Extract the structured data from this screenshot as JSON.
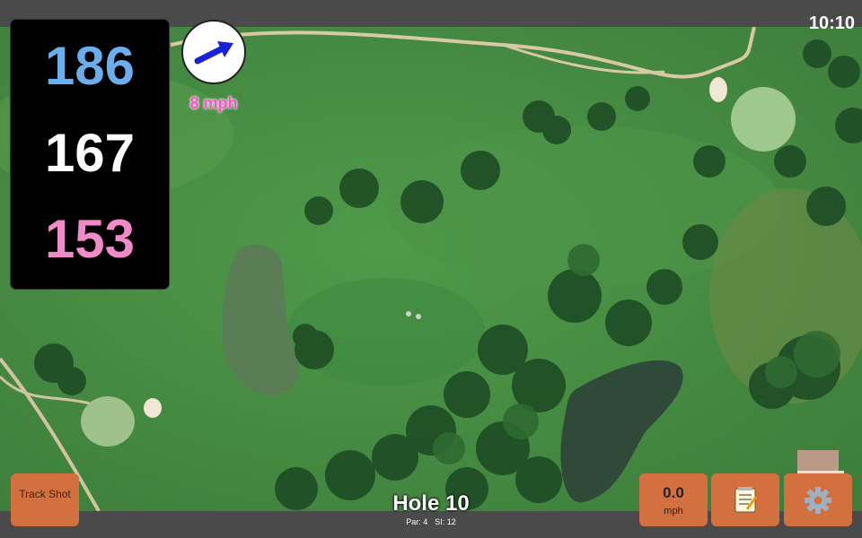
{
  "status": {
    "time": "10:10"
  },
  "distances": {
    "back": "186",
    "middle": "167",
    "front": "153"
  },
  "wind": {
    "speed_label": "8 mph",
    "direction_icon": "wind-arrow-icon"
  },
  "hole": {
    "title": "Hole 10",
    "par": "Par: 4",
    "si": "SI: 12"
  },
  "buttons": {
    "track_shot": "Track Shot",
    "wind_value": "0.0",
    "wind_unit": "mph",
    "notes_icon": "notepad-icon",
    "settings_icon": "gear-icon"
  },
  "colors": {
    "back": "#6aaeee",
    "middle": "#ffffff",
    "front": "#f08ac8",
    "wind_text": "#ff4fd0",
    "button": "#d3703f",
    "arrow": "#1a22d8"
  }
}
